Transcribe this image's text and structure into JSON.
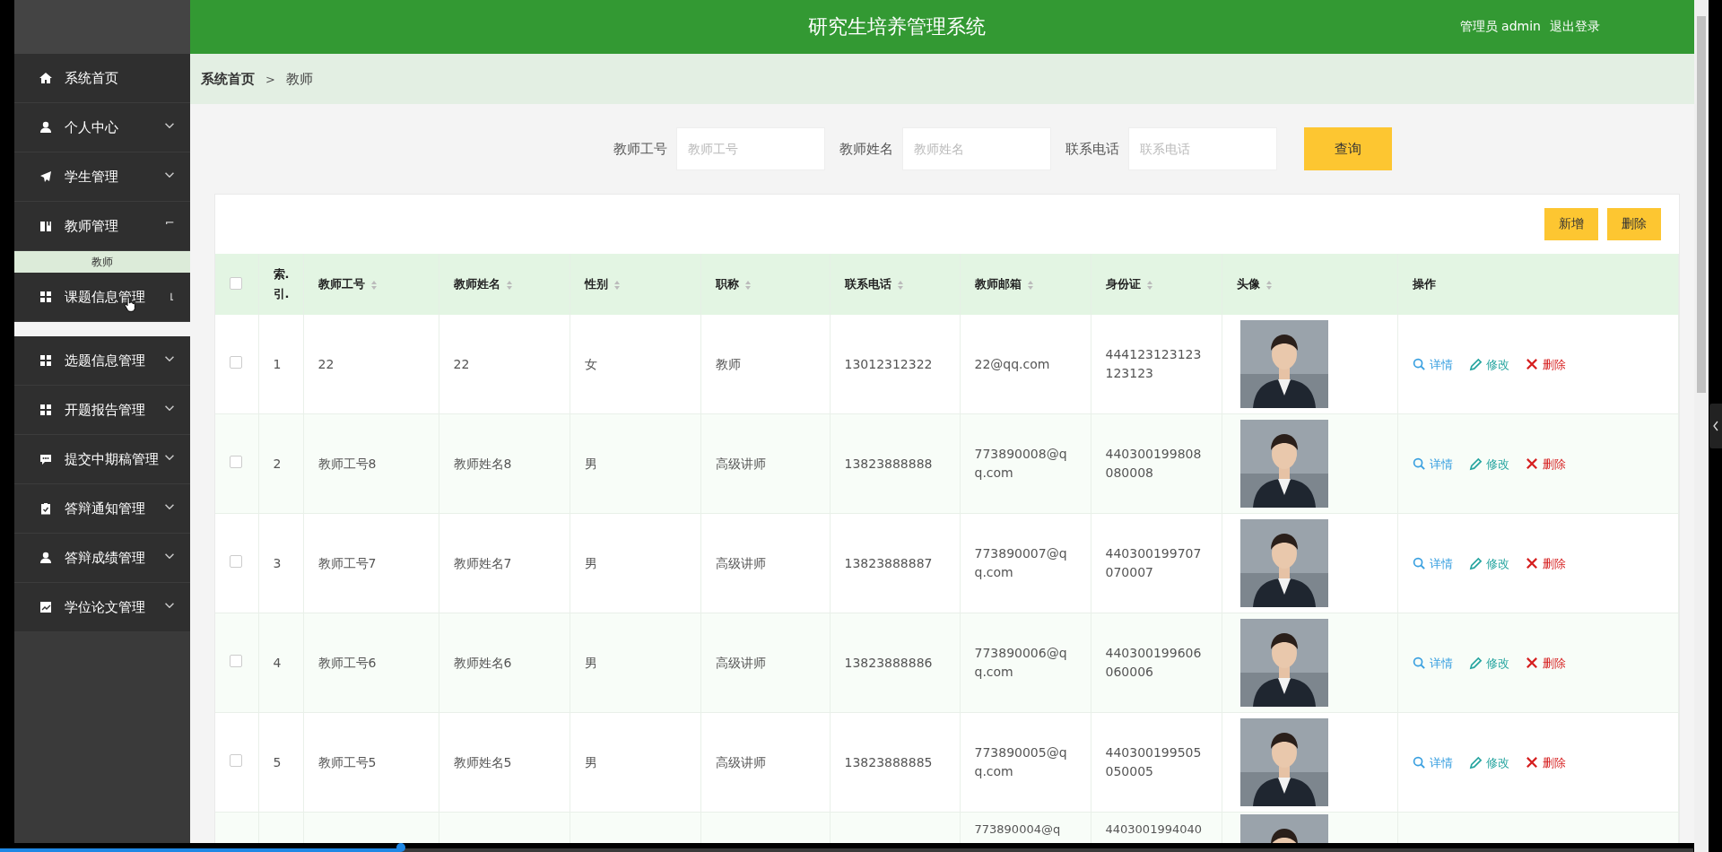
{
  "header": {
    "title": "研究生培养管理系统",
    "user": "管理员 admin",
    "logout": "退出登录"
  },
  "sidebar": {
    "items": [
      {
        "label": "系统首页"
      },
      {
        "label": "个人中心",
        "expanded": false
      },
      {
        "label": "学生管理",
        "expanded": false
      },
      {
        "label": "教师管理",
        "expanded": true,
        "children": [
          {
            "label": "教师",
            "selected": true
          }
        ]
      },
      {
        "label": "课题信息管理",
        "expanded": true,
        "hovered": true
      },
      {
        "label": "选题信息管理",
        "expanded": false
      },
      {
        "label": "开题报告管理",
        "expanded": false
      },
      {
        "label": "提交中期稿管理",
        "expanded": false
      },
      {
        "label": "答辩通知管理",
        "expanded": false
      },
      {
        "label": "答辩成绩管理",
        "expanded": false
      },
      {
        "label": "学位论文管理",
        "expanded": false
      }
    ]
  },
  "breadcrumb": [
    "系统首页",
    ">",
    "教师"
  ],
  "search": {
    "fields": [
      {
        "label": "教师工号",
        "placeholder": "教师工号"
      },
      {
        "label": "教师姓名",
        "placeholder": "教师姓名"
      },
      {
        "label": "联系电话",
        "placeholder": "联系电话"
      }
    ],
    "button": "查询"
  },
  "toolbar": [
    "新增",
    "删除"
  ],
  "table": {
    "select_all_checked": false,
    "columns": [
      {
        "label": "索.\n引.",
        "sortable": false
      },
      {
        "label": "教师工号",
        "sortable": true
      },
      {
        "label": "教师姓名",
        "sortable": true
      },
      {
        "label": "性别",
        "sortable": true
      },
      {
        "label": "职称",
        "sortable": true
      },
      {
        "label": "联系电话",
        "sortable": true
      },
      {
        "label": "教师邮箱",
        "sortable": true
      },
      {
        "label": "身份证",
        "sortable": true
      },
      {
        "label": "头像",
        "sortable": true
      },
      {
        "label": "操作",
        "sortable": false
      }
    ],
    "rows": [
      {
        "checked": false,
        "cells": [
          "1",
          "22",
          "22",
          "女",
          "教师",
          "13012312322",
          "22@qq.com",
          "444123123123123123"
        ],
        "actions": [
          "详情",
          "修改",
          "删除"
        ]
      },
      {
        "checked": false,
        "cells": [
          "2",
          "教师工号8",
          "教师姓名8",
          "男",
          "高级讲师",
          "13823888888",
          "773890008@qq.com",
          "440300199808080008"
        ],
        "actions": [
          "详情",
          "修改",
          "删除"
        ]
      },
      {
        "checked": false,
        "cells": [
          "3",
          "教师工号7",
          "教师姓名7",
          "男",
          "高级讲师",
          "13823888887",
          "773890007@qq.com",
          "440300199707070007"
        ],
        "actions": [
          "详情",
          "修改",
          "删除"
        ]
      },
      {
        "checked": false,
        "cells": [
          "4",
          "教师工号6",
          "教师姓名6",
          "男",
          "高级讲师",
          "13823888886",
          "773890006@qq.com",
          "440300199606060006"
        ],
        "actions": [
          "详情",
          "修改",
          "删除"
        ]
      },
      {
        "checked": false,
        "cells": [
          "5",
          "教师工号5",
          "教师姓名5",
          "男",
          "高级讲师",
          "13823888885",
          "773890005@qq.com",
          "440300199505050005"
        ],
        "actions": [
          "详情",
          "修改",
          "删除"
        ]
      }
    ],
    "partial_row": {
      "email": "773890004@q",
      "id_card": "4403001994040"
    }
  },
  "video_progress": {
    "level": 0.237
  }
}
